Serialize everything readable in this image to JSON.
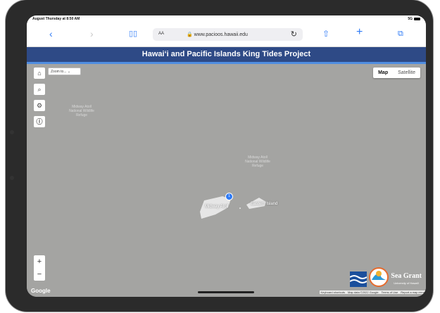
{
  "status_bar": {
    "time": "August Thursday at 8:50 AM",
    "signal": "5G"
  },
  "browser": {
    "text_size_label": "AA",
    "url": "www.pacioos.hawaii.edu"
  },
  "banner": {
    "title": "Hawaiʻi and Pacific Islands King Tides Project"
  },
  "map": {
    "zoom_select": "Zoom to...",
    "map_types": [
      "Map",
      "Satellite"
    ],
    "selected_type": "Map",
    "labels": {
      "refuge_top": "Midway Atoll National Wildlife Refuge",
      "refuge_center": "Midway Atoll National Wildlife Refuge",
      "midway_atoll": "Midway Atoll",
      "eastern_island": "Eastern Island",
      "marker_count": "1"
    },
    "google": "Google",
    "attribution": [
      "Keyboard shortcuts",
      "Map data ©2022 Google",
      "Terms of Use",
      "Report a map error"
    ]
  },
  "logos": {
    "sea_grant": "Sea Grant",
    "sea_grant_sub": "University of Hawai'i"
  },
  "colors": {
    "banner": "#2e4a86",
    "accent": "#2f7bf6",
    "map_bg": "#a4a4a2"
  },
  "icons": [
    "chevron-left-icon",
    "chevron-right-icon",
    "book-icon",
    "lock-icon",
    "reload-icon",
    "share-icon",
    "plus-icon",
    "tabs-icon",
    "home-icon",
    "search-icon",
    "gear-icon",
    "info-icon"
  ]
}
